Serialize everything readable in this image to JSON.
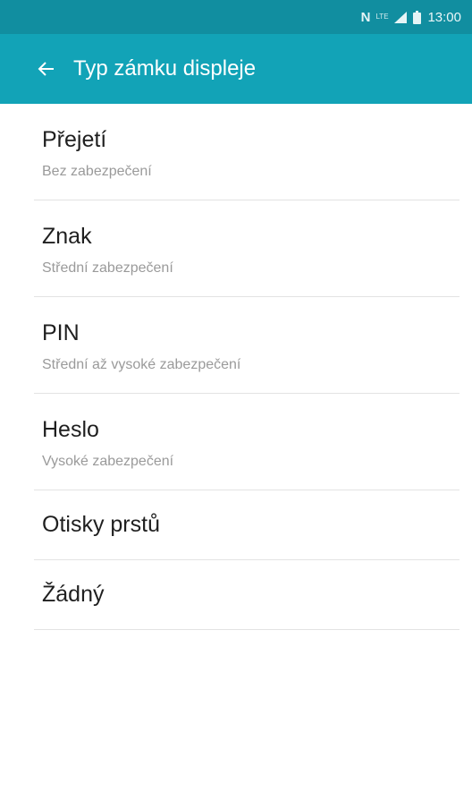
{
  "status_bar": {
    "time": "13:00",
    "nfc_glyph": "N",
    "network_glyph": "LTE",
    "icons": [
      "nfc-icon",
      "lte-icon",
      "signal-icon",
      "battery-icon"
    ]
  },
  "app_bar": {
    "title": "Typ zámku displeje",
    "back_icon": "arrow-left-icon"
  },
  "options": [
    {
      "title": "Přejetí",
      "subtitle": "Bez zabezpečení"
    },
    {
      "title": "Znak",
      "subtitle": "Střední zabezpečení"
    },
    {
      "title": "PIN",
      "subtitle": "Střední až vysoké zabezpečení"
    },
    {
      "title": "Heslo",
      "subtitle": "Vysoké zabezpečení"
    },
    {
      "title": "Otisky prstů",
      "subtitle": ""
    },
    {
      "title": "Žádný",
      "subtitle": ""
    }
  ],
  "colors": {
    "status_bar": "#118ea0",
    "app_bar": "#12a3b7",
    "divider": "#e3e3e3",
    "primary_text": "#1f1f1f",
    "secondary_text": "#9a9a9a"
  }
}
